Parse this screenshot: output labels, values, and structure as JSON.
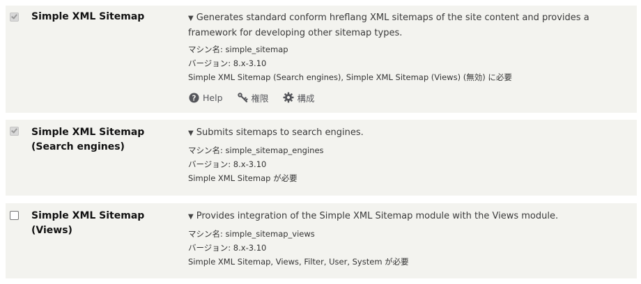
{
  "modules": [
    {
      "name": "Simple XML Sitemap",
      "checked": true,
      "disabled": true,
      "description": "Generates standard conform hreflang XML sitemaps of the site content and provides a framework for developing other sitemap types.",
      "machine_name": "マシン名: simple_sitemap",
      "version": "バージョン: 8.x-3.10",
      "required_by": "Simple XML Sitemap (Search engines), Simple XML Sitemap (Views) (無効) に必要",
      "links": {
        "help": "Help",
        "permissions": "権限",
        "configure": "構成"
      }
    },
    {
      "name": "Simple XML Sitemap (Search engines)",
      "checked": true,
      "disabled": true,
      "description": "Submits sitemaps to search engines.",
      "machine_name": "マシン名: simple_sitemap_engines",
      "version": "バージョン: 8.x-3.10",
      "requires": "Simple XML Sitemap が必要"
    },
    {
      "name": "Simple XML Sitemap (Views)",
      "checked": false,
      "disabled": false,
      "description": "Provides integration of the Simple XML Sitemap module with the Views module.",
      "machine_name": "マシン名: simple_sitemap_views",
      "version": "バージョン: 8.x-3.10",
      "requires": "Simple XML Sitemap, Views, Filter, User, System が必要"
    }
  ],
  "disclosure_glyph": "▼",
  "icons": [
    "help-icon",
    "permissions-icon",
    "configure-icon"
  ]
}
